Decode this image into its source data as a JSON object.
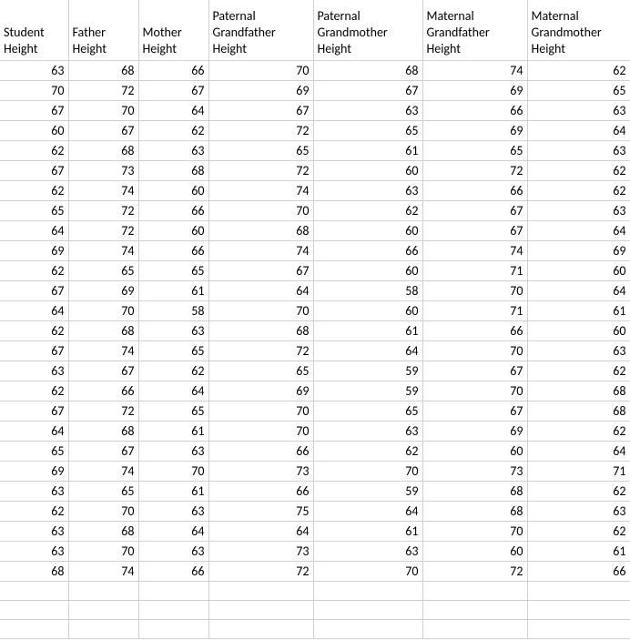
{
  "headers": [
    "Student Height",
    "Father Height",
    "Mother Height",
    "Paternal Grandfather Height",
    "Paternal Grandmother Height",
    "Maternal Grandfather Height",
    "Maternal Grandmother Height"
  ],
  "rows": [
    [
      63,
      68,
      66,
      70,
      68,
      74,
      62
    ],
    [
      70,
      72,
      67,
      69,
      67,
      69,
      65
    ],
    [
      67,
      70,
      64,
      67,
      63,
      66,
      63
    ],
    [
      60,
      67,
      62,
      72,
      65,
      69,
      64
    ],
    [
      62,
      68,
      63,
      65,
      61,
      65,
      63
    ],
    [
      67,
      73,
      68,
      72,
      60,
      72,
      62
    ],
    [
      62,
      74,
      60,
      74,
      63,
      66,
      62
    ],
    [
      65,
      72,
      66,
      70,
      62,
      67,
      63
    ],
    [
      64,
      72,
      60,
      68,
      60,
      67,
      64
    ],
    [
      69,
      74,
      66,
      74,
      66,
      74,
      69
    ],
    [
      62,
      65,
      65,
      67,
      60,
      71,
      60
    ],
    [
      67,
      69,
      61,
      64,
      58,
      70,
      64
    ],
    [
      64,
      70,
      58,
      70,
      60,
      71,
      61
    ],
    [
      62,
      68,
      63,
      68,
      61,
      66,
      60
    ],
    [
      67,
      74,
      65,
      72,
      64,
      70,
      63
    ],
    [
      63,
      67,
      62,
      65,
      59,
      67,
      62
    ],
    [
      62,
      66,
      64,
      69,
      59,
      70,
      68
    ],
    [
      67,
      72,
      65,
      70,
      65,
      67,
      68
    ],
    [
      64,
      68,
      61,
      70,
      63,
      69,
      62
    ],
    [
      65,
      67,
      63,
      66,
      62,
      60,
      64
    ],
    [
      69,
      74,
      70,
      73,
      70,
      73,
      71
    ],
    [
      63,
      65,
      61,
      66,
      59,
      68,
      62
    ],
    [
      62,
      70,
      63,
      75,
      64,
      68,
      63
    ],
    [
      63,
      68,
      64,
      64,
      61,
      70,
      62
    ],
    [
      63,
      70,
      63,
      73,
      63,
      60,
      61
    ],
    [
      68,
      74,
      66,
      72,
      70,
      72,
      66
    ]
  ]
}
